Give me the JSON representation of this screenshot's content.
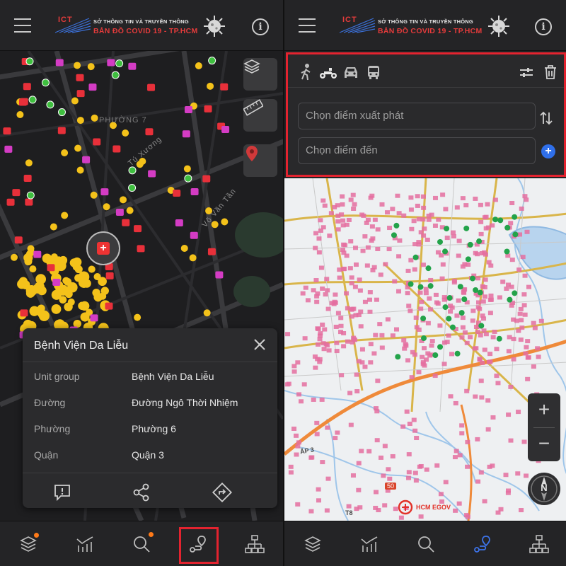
{
  "brand": {
    "logo_mark": "ICT",
    "org": "SỞ THÔNG TIN VÀ TRUYỀN THÔNG",
    "product": "BẢN ĐỒ  COVID 19 - TP.HCM"
  },
  "left_map": {
    "labels": {
      "ward": "PHƯỜNG 7",
      "street1": "Tú Xương",
      "street2": "Võ Văn Tần"
    },
    "tools": [
      "layers-icon",
      "ruler-icon",
      "marker-pin-icon"
    ]
  },
  "popup": {
    "title": "Bệnh Viện Da Liễu",
    "rows": [
      {
        "key": "Unit group",
        "value": "Bệnh Viện Da Liễu"
      },
      {
        "key": "Đường",
        "value": "Đường Ngô Thời Nhiệm"
      },
      {
        "key": "Phường",
        "value": "Phường 6"
      },
      {
        "key": "Quận",
        "value": "Quận 3"
      }
    ],
    "actions": [
      "report-icon",
      "share-icon",
      "directions-icon"
    ]
  },
  "route_panel": {
    "modes": [
      "walk-icon",
      "motorbike-icon",
      "car-icon",
      "bus-icon"
    ],
    "start_placeholder": "Chọn điểm xuất phát",
    "end_placeholder": "Chọn điểm đến",
    "add_symbol": "+"
  },
  "right_map": {
    "zoom_in": "+",
    "zoom_out": "−",
    "compass": "N",
    "egov": "HCM EGOV",
    "road_ap3": "ẤP 3",
    "road_50": "50",
    "road_t8": "T8"
  },
  "bottom_nav": [
    "layers-icon",
    "chart-icon",
    "search-icon",
    "route-icon",
    "org-chart-icon"
  ],
  "colors": {
    "highlight": "#e3232f",
    "accent_blue": "#2f6fea",
    "dot_orange": "#ff7a18"
  }
}
